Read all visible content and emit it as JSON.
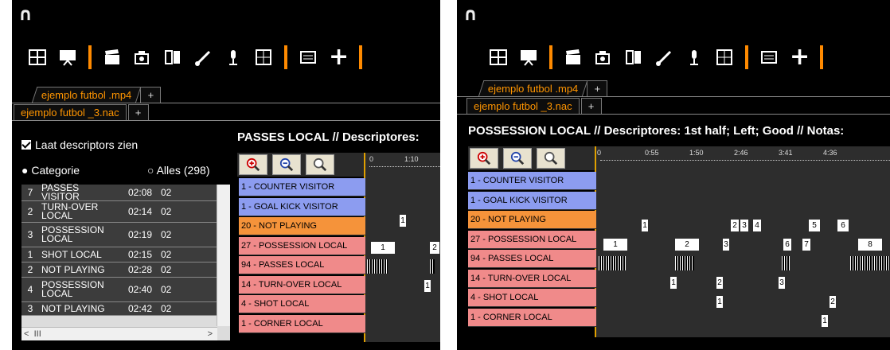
{
  "left": {
    "logo": "∩",
    "tab_video": "ejemplo futbol .mp4",
    "tab_add1": "+",
    "tab_nac": "ejemplo futbol _3.nac",
    "tab_add2": "+",
    "checkbox_label": "Laat descriptors zien",
    "radio_categorie": "Categorie",
    "radio_alles": "Alles (298)",
    "rows": [
      {
        "n": "7",
        "name": "PASSES VISITOR",
        "time": "02:08",
        "x": "02"
      },
      {
        "n": "2",
        "name": "TURN-OVER LOCAL",
        "time": "02:14",
        "x": "02"
      },
      {
        "n": "3",
        "name": "POSSESSION LOCAL",
        "time": "02:19",
        "x": "02"
      },
      {
        "n": "1",
        "name": "SHOT LOCAL",
        "time": "02:15",
        "x": "02"
      },
      {
        "n": "2",
        "name": "NOT PLAYING",
        "time": "02:28",
        "x": "02"
      },
      {
        "n": "4",
        "name": "POSSESSION LOCAL",
        "time": "02:40",
        "x": "02"
      },
      {
        "n": "3",
        "name": "NOT PLAYING",
        "time": "02:42",
        "x": "02"
      }
    ],
    "hscroll_grip": "III",
    "title": "PASSES LOCAL // Descriptores:",
    "ruler": [
      "0",
      "1:10"
    ],
    "descriptors": [
      {
        "label": "1 - COUNTER VISITOR",
        "color": "#8c9cf0"
      },
      {
        "label": "1 - GOAL KICK VISITOR",
        "color": "#8c9cf0"
      },
      {
        "label": "20 - NOT PLAYING",
        "color": "#f5933a"
      },
      {
        "label": "27 - POSSESSION LOCAL",
        "color": "#f08a8a"
      },
      {
        "label": "94 - PASSES LOCAL",
        "color": "#f08a8a"
      },
      {
        "label": "14 - TURN-OVER LOCAL",
        "color": "#f08a8a"
      },
      {
        "label": "4 - SHOT LOCAL",
        "color": "#f08a8a"
      },
      {
        "label": "1 - CORNER LOCAL",
        "color": "#f08a8a"
      }
    ],
    "marks": [
      "1",
      "1",
      "2",
      "1"
    ]
  },
  "right": {
    "logo": "∩",
    "tab_video": "ejemplo futbol .mp4",
    "tab_add1": "+",
    "tab_nac": "ejemplo futbol _3.nac",
    "tab_add2": "+",
    "title": "POSSESSION LOCAL // Descriptores: 1st half; Left; Good // Notas:",
    "ruler": [
      "0",
      "0:55",
      "1:50",
      "2:46",
      "3:41",
      "4:36"
    ],
    "descriptors": [
      {
        "label": "1 - COUNTER VISITOR",
        "color": "#8c9cf0"
      },
      {
        "label": "1 - GOAL KICK VISITOR",
        "color": "#8c9cf0"
      },
      {
        "label": "20 - NOT PLAYING",
        "color": "#f5933a"
      },
      {
        "label": "27 - POSSESSION LOCAL",
        "color": "#f08a8a"
      },
      {
        "label": "94 - PASSES LOCAL",
        "color": "#f08a8a"
      },
      {
        "label": "14 - TURN-OVER LOCAL",
        "color": "#f08a8a"
      },
      {
        "label": "4 - SHOT LOCAL",
        "color": "#f08a8a"
      },
      {
        "label": "1 - CORNER LOCAL",
        "color": "#f08a8a"
      }
    ],
    "marks_not_playing": [
      "1",
      "2",
      "3",
      "4",
      "5",
      "6"
    ],
    "marks_possession": [
      "1",
      "2",
      "3",
      "6",
      "7",
      "8"
    ],
    "marks_turnover": [
      "1",
      "2",
      "3"
    ],
    "marks_shot": [
      "1",
      "2"
    ],
    "marks_corner": [
      "1"
    ]
  }
}
